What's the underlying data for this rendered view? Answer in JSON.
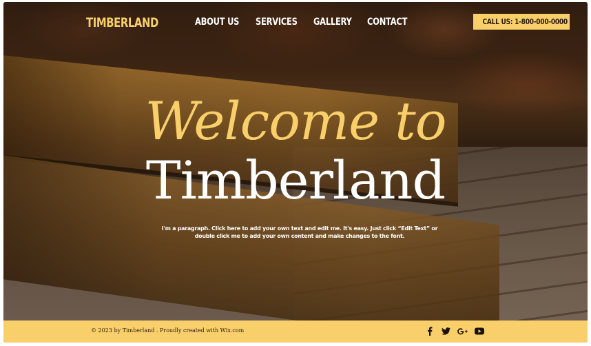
{
  "header": {
    "logo": "TIMBERLAND",
    "nav": [
      "ABOUT US",
      "SERVICES",
      "GALLERY",
      "CONTACT"
    ],
    "call_button": "CALL US: 1-800-000-0000"
  },
  "hero": {
    "welcome": "Welcome to",
    "title": "Timberland",
    "paragraph": "I'm a paragraph. Click here to add your own text and edit me. It's easy. Just click “Edit Text” or double click me to add your own content and make changes to the font."
  },
  "footer": {
    "copyright": "© 2023 by Timberland . Proudly created with Wix.com",
    "socials": [
      "facebook-icon",
      "twitter-icon",
      "google-plus-icon",
      "youtube-icon"
    ]
  },
  "colors": {
    "accent": "#f8cf6a",
    "text_light": "#ffffff",
    "text_dark": "#2b1c0c"
  }
}
